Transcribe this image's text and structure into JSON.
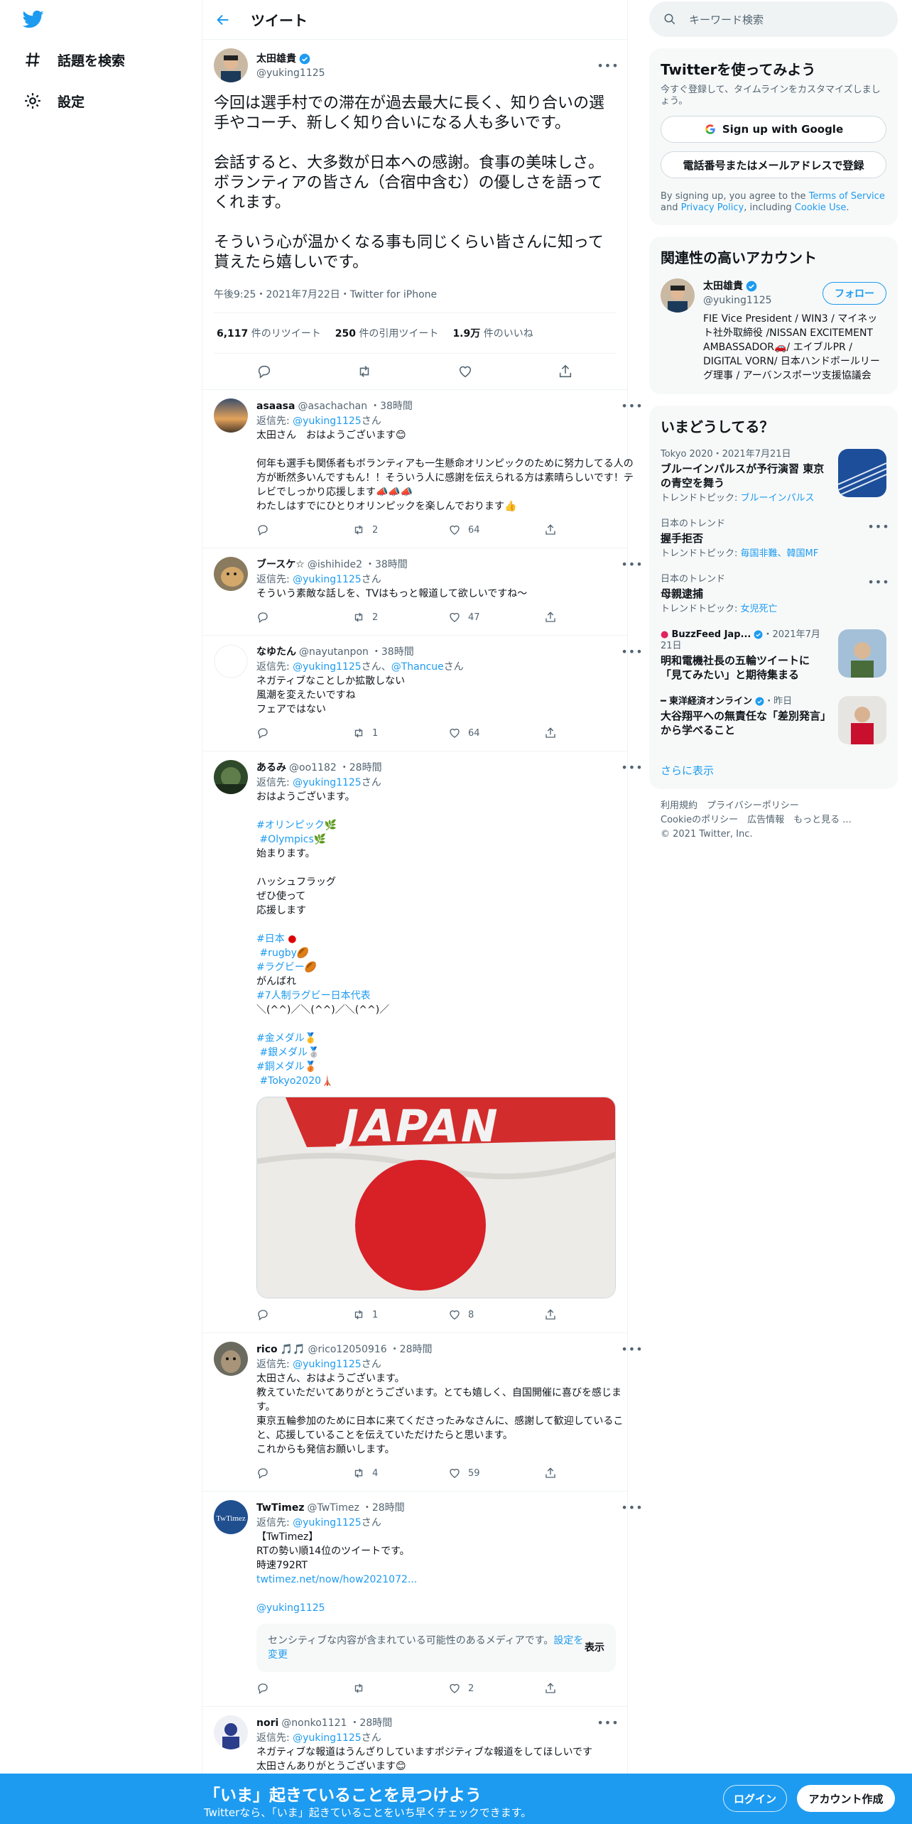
{
  "nav": {
    "logo_icon": "twitter-bird-icon",
    "items": [
      {
        "label": "話題を検索",
        "icon": "hashtag-icon"
      },
      {
        "label": "設定",
        "icon": "gear-icon"
      }
    ]
  },
  "header": {
    "title": "ツイート",
    "back_icon": "back-arrow-icon"
  },
  "main_tweet": {
    "author_name": "太田雄貴",
    "author_handle": "@yuking1125",
    "text": "今回は選手村での滞在が過去最大に長く、知り合いの選手やコーチ、新しく知り合いになる人も多いです。\n\n会話すると、大多数が日本への感謝。食事の美味しさ。ボランティアの皆さん（合宿中含む）の優しさを語ってくれます。\n\nそういう心が温かくなる事も同じくらい皆さんに知って貰えたら嬉しいです。",
    "meta": "午後9:25・2021年7月22日・Twitter for iPhone",
    "retweets_count": "6,117",
    "retweets_label": "件のリツイート",
    "quotes_count": "250",
    "quotes_label": "件の引用ツイート",
    "likes_count": "1.9万",
    "likes_label": "件のいいね"
  },
  "replies": [
    {
      "name": "asaasa",
      "handle": "@asachachan",
      "time": "・38時間",
      "reply_prefix": "返信先: ",
      "reply_to": "@yuking1125",
      "reply_suffix": "さん",
      "text": "太田さん　おはようございます😊\n\n何年も選手も関係者もボランティアも一生懸命オリンピックのために努力してる人の方が断然多いんですもん！！そういう人に感謝を伝えられる方は素晴らしいです！テレビでしっかり応援します📣📣📣\nわたしはすでにひとりオリンピックを楽しんでおります👍",
      "retweets": "2",
      "likes": "64"
    },
    {
      "name": "ブースケ☆",
      "handle": "@ishihide2",
      "time": "・38時間",
      "reply_prefix": "返信先: ",
      "reply_to": "@yuking1125",
      "reply_suffix": "さん",
      "text": "そういう素敵な話しを、TVはもっと報道して欲しいですね〜",
      "retweets": "2",
      "likes": "47"
    },
    {
      "name": "なゆたん",
      "handle": "@nayutanpon",
      "time": "・38時間",
      "reply_prefix": "返信先: ",
      "reply_to": "@yuking1125",
      "reply_mid": "さん、",
      "reply_to2": "@Thancue",
      "reply_suffix": "さん",
      "text": "ネガティブなことしか拡散しない\n風潮を変えたいですね\nフェアではない",
      "retweets": "1",
      "likes": "64"
    },
    {
      "name": "あるみ",
      "handle": "@oo1182",
      "time": "・28時間",
      "reply_prefix": "返信先: ",
      "reply_to": "@yuking1125",
      "reply_suffix": "さん",
      "text_intro": "おはようございます。",
      "tag1": "#オリンピック",
      "tag2": "#Olympics",
      "text2": "始まります。\n\nハッシュフラッグ\nぜひ使って\n応援します",
      "tag3": "#日本",
      "tag4": "#rugby",
      "tag5": "#ラグビー",
      "text3": "がんばれ",
      "tag6": "#7人制ラグビー日本代表",
      "text4": "＼(^^)／＼(^^)／＼(^^)／",
      "tag7": "#金メダル",
      "tag8": "#銀メダル",
      "tag9": "#銅メダル",
      "tag10": "#Tokyo2020",
      "media_text": "JAPAN",
      "retweets": "1",
      "likes": "8"
    },
    {
      "name": "rico",
      "name_emoji": "🎵🎵",
      "handle": "@rico12050916",
      "time": "・28時間",
      "reply_prefix": "返信先: ",
      "reply_to": "@yuking1125",
      "reply_suffix": "さん",
      "text": "太田さん、おはようございます。\n教えていただいてありがとうございます。とても嬉しく、自国開催に喜びを感じます。\n東京五輪参加のために日本に来てくださったみなさんに、感謝して歓迎していること、応援していることを伝えていただけたらと思います。\nこれからも発信お願いします。",
      "retweets": "4",
      "likes": "59"
    },
    {
      "name": "TwTimez",
      "handle": "@TwTimez",
      "time": "・28時間",
      "reply_prefix": "返信先: ",
      "reply_to": "@yuking1125",
      "reply_suffix": "さん",
      "text": "【TwTimez】\nRTの勢い順14位のツイートです。\n時速792RT",
      "link": "twtimez.net/now/how2021072...",
      "mention": "@yuking1125",
      "sensitive_text": "センシティブな内容が含まれている可能性のあるメディアです。",
      "sensitive_link": "設定を変更",
      "sensitive_show": "表示",
      "retweets": "",
      "likes": "2"
    },
    {
      "name": "nori",
      "handle": "@nonko1121",
      "time": "・28時間",
      "reply_prefix": "返信先: ",
      "reply_to": "@yuking1125",
      "reply_suffix": "さん",
      "text": "ネガティブな報道はうんざりしていますポジティブな報道をしてほしいです\n太田さんありがとうございます😊",
      "retweets": "",
      "likes": ""
    }
  ],
  "right": {
    "search_placeholder": "キーワード検索",
    "signup": {
      "title": "Twitterを使ってみよう",
      "desc": "今すぐ登録して、タイムラインをカスタマイズしましょう。",
      "google_btn": "Sign up with Google",
      "phone_btn": "電話番号またはメールアドレスで登録",
      "legal_1": "By signing up, you agree to the ",
      "legal_tos": "Terms of Service",
      "legal_2": " and ",
      "legal_privacy": "Privacy Policy",
      "legal_3": ", including ",
      "legal_cookie": "Cookie Use",
      "legal_4": "."
    },
    "related": {
      "title": "関連性の高いアカウント",
      "name": "太田雄貴",
      "handle": "@yuking1125",
      "follow": "フォロー",
      "bio": "FIE Vice President / WIN3 / マイネット社外取締役 /NISSAN EXCITEMENT AMBASSADOR🚗/ エイブルPR / DIGITAL VORN/ 日本ハンドボールリーグ理事 / アーバンスポーツ支援協議会"
    },
    "trends": {
      "title": "いまどうしてる？",
      "items": [
        {
          "meta": "Tokyo 2020・2021年7月21日",
          "title": "ブルーインパルスが予行演習 東京の青空を舞う",
          "topic_label": "トレンドトピック: ",
          "topic": "ブルーインパルス",
          "has_image": true
        },
        {
          "meta": "日本のトレンド",
          "title": "握手拒否",
          "topic_label": "トレンドトピック: ",
          "topic": "毎国非難、韓国MF",
          "has_image": false
        },
        {
          "meta": "日本のトレンド",
          "title": "母親逮捕",
          "topic_label": "トレンドトピック: ",
          "topic": "女児死亡",
          "has_image": false
        },
        {
          "meta_source": "BuzzFeed Jap...",
          "meta": "・2021年7月21日",
          "title": "明和電機社長の五輪ツイートに「見てみたい」と期待集まる",
          "has_image": true
        },
        {
          "meta_source": "東洋経済オンライン",
          "meta": "・昨日",
          "title": "大谷翔平への無責任な「差別発言」から学べること",
          "has_image": true
        }
      ],
      "show_more": "さらに表示"
    },
    "footer": {
      "links": [
        "利用規約",
        "プライバシーポリシー",
        "Cookieのポリシー",
        "広告情報",
        "もっと見る ..."
      ],
      "copyright": "© 2021 Twitter, Inc."
    }
  },
  "bottom_bar": {
    "title": "「いま」起きていることを見つけよう",
    "subtitle": "Twitterなら、「いま」起きていることをいち早くチェックできます。",
    "login": "ログイン",
    "signup": "アカウント作成"
  },
  "colors": {
    "brand": "#1d9bf0",
    "text": "#0f1419",
    "muted": "#536471",
    "border": "#eff3f4"
  }
}
